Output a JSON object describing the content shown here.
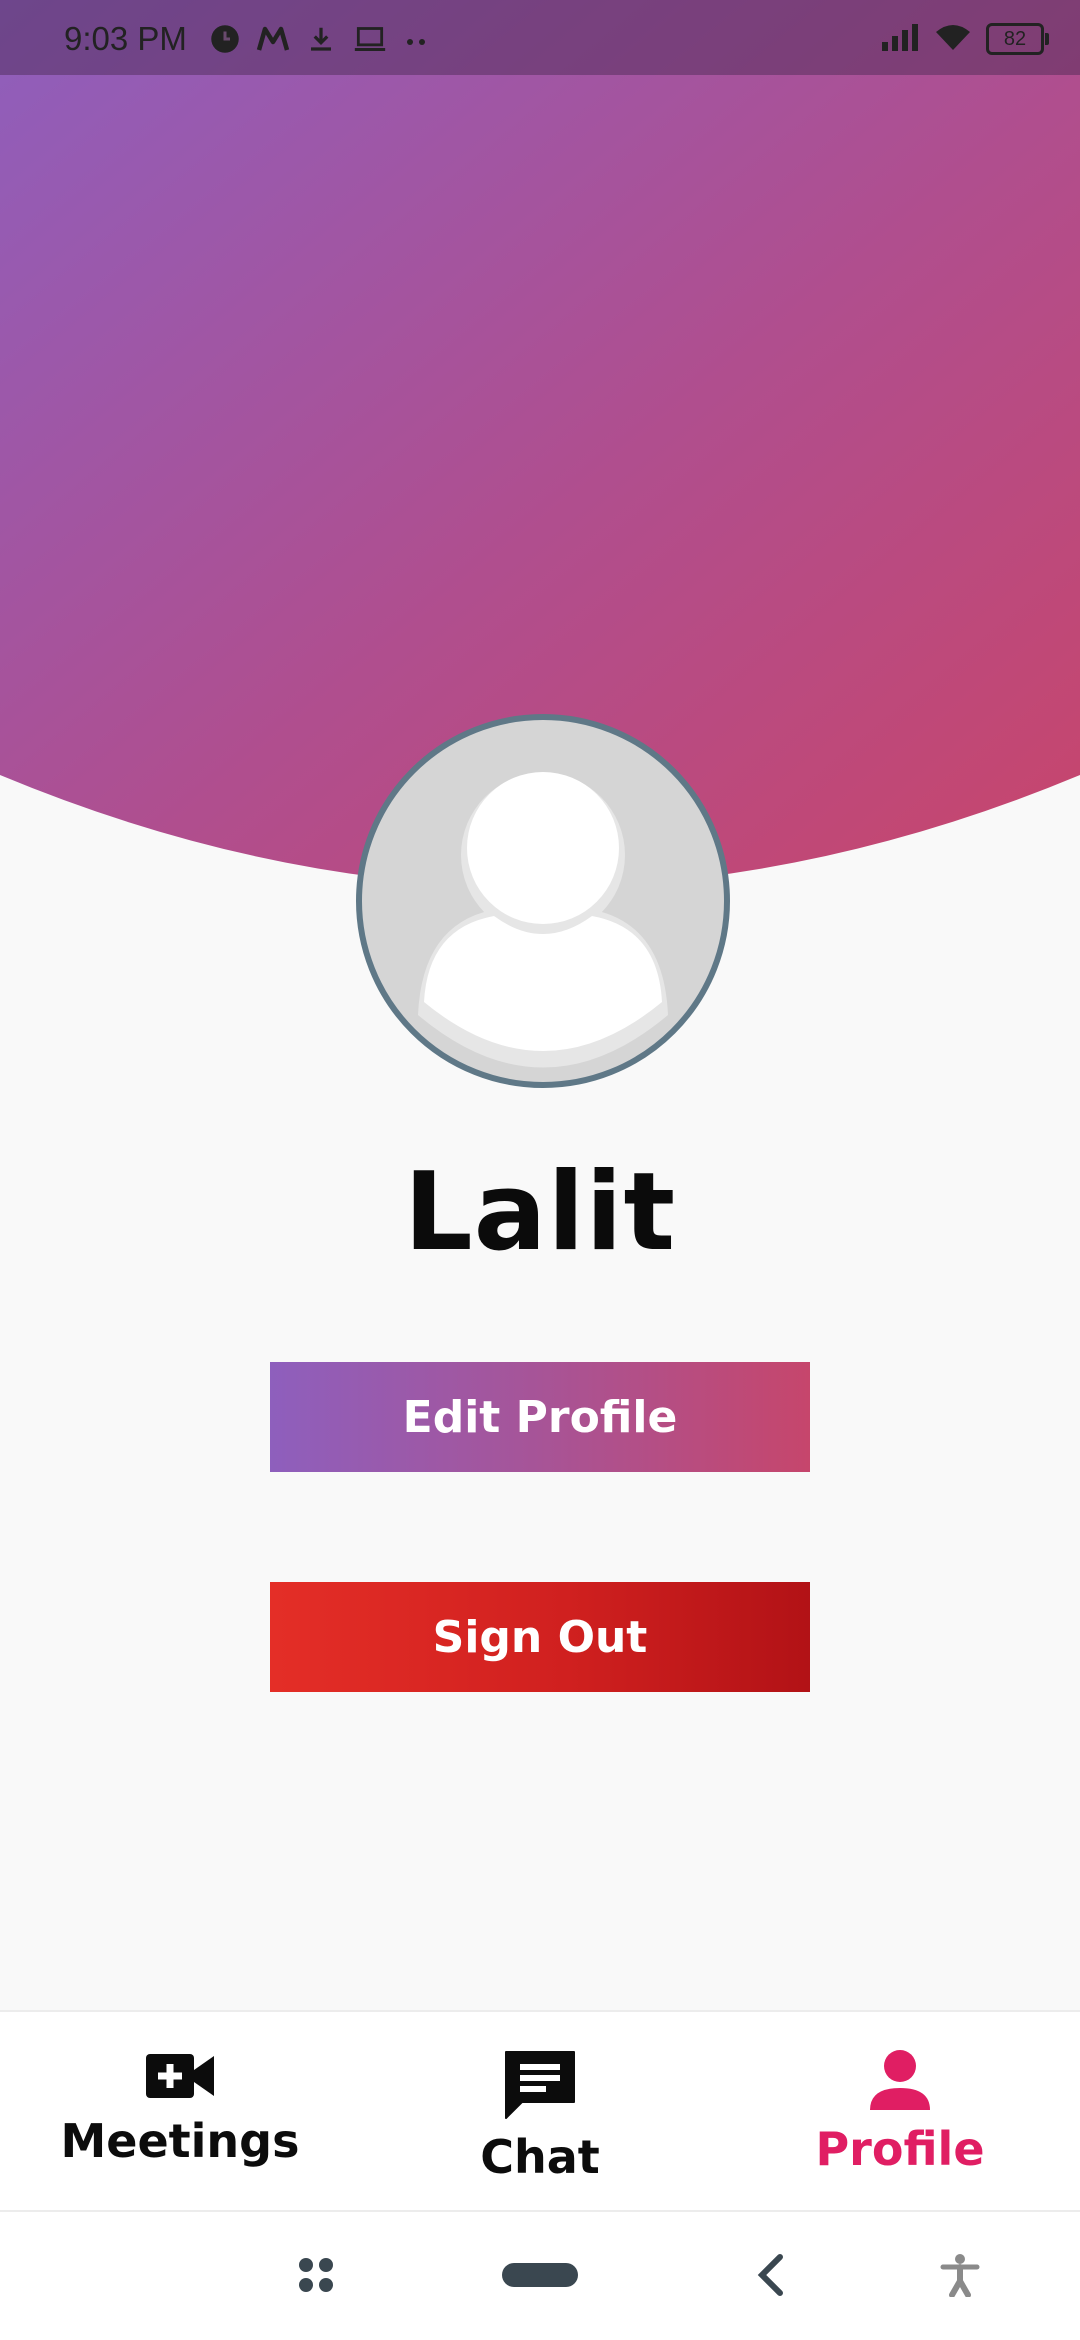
{
  "status_bar": {
    "time": "9:03 PM",
    "battery": "82"
  },
  "profile": {
    "name": "Lalit",
    "edit_label": "Edit Profile",
    "signout_label": "Sign Out"
  },
  "bottom_nav": {
    "items": [
      {
        "label": "Meetings",
        "icon": "video-add-icon",
        "active": false
      },
      {
        "label": "Chat",
        "icon": "chat-icon",
        "active": false
      },
      {
        "label": "Profile",
        "icon": "person-icon",
        "active": true
      }
    ]
  },
  "colors": {
    "gradient_start": "#8e5fbd",
    "gradient_end": "#c6466c",
    "signout_start": "#e42e27",
    "signout_end": "#b21216",
    "active_nav": "#e01e63",
    "avatar_border": "#5f7887"
  }
}
